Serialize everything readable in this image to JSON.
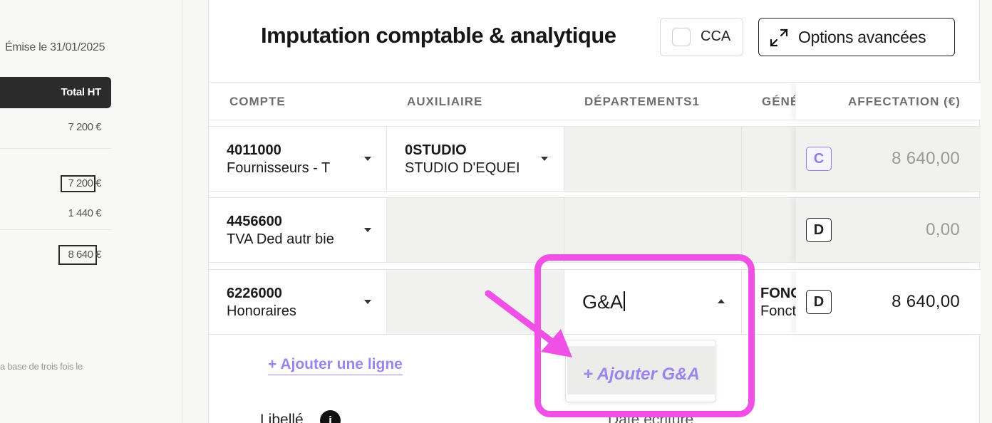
{
  "invoice": {
    "date": "Émise le 31/01/2025",
    "total_header": "Total HT",
    "value_1": "7 200 €",
    "value_2": "7 200 €",
    "value_3": "1 440 €",
    "value_4": "8 640 €",
    "note": "a base de trois fois le"
  },
  "panel": {
    "title": "Imputation comptable & analytique",
    "cca_label": "CCA",
    "advanced_label": "Options avancées"
  },
  "table": {
    "headers": [
      "COMPTE",
      "AUXILIAIRE",
      "DÉPARTEMENTS1",
      "GÉNÉ",
      "AFFECTATION (€)"
    ],
    "rows": [
      {
        "account_code": "4011000",
        "account_name": "Fournisseurs - T",
        "aux_code": "0STUDIO",
        "aux_name": "STUDIO D'EQUEI",
        "badge": "C",
        "amount": "8 640,00"
      },
      {
        "account_code": "4456600",
        "account_name": "TVA Ded autr bie",
        "badge": "D",
        "amount": "0,00"
      },
      {
        "account_code": "6226000",
        "account_name": "Honoraires",
        "department_input": "G&A",
        "gen_code": "FONC",
        "gen_name": "Fonct",
        "badge": "D",
        "amount": "8 640,00"
      }
    ]
  },
  "actions": {
    "add_line": "+ Ajouter une ligne",
    "dropdown_option": "+ Ajouter G&A"
  },
  "footer": {
    "libelle": "Libellé",
    "date_ecriture": "Date écriture"
  },
  "colors": {
    "accent": "#9b84ee",
    "highlight": "#f050e6"
  }
}
